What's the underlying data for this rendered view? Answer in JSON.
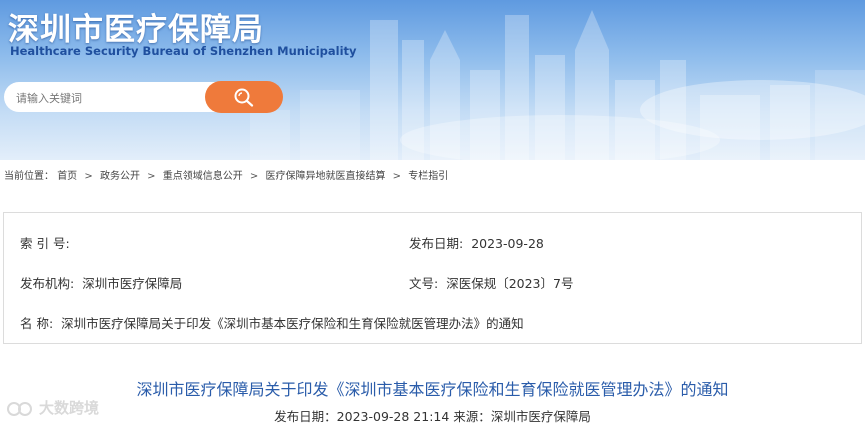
{
  "header": {
    "title": "深圳市医疗保障局",
    "subtitle": "Healthcare Security Bureau of Shenzhen Municipality"
  },
  "search": {
    "placeholder": "请输入关键词",
    "button_icon": "search-icon"
  },
  "breadcrumb": {
    "prefix": "当前位置：",
    "items": [
      "首页",
      "政务公开",
      "重点领域信息公开",
      "医疗保障异地就医直接结算",
      "专栏指引"
    ],
    "separator": ">"
  },
  "info": {
    "index_label": "索 引 号:",
    "index_value": "",
    "date_label": "发布日期:",
    "date_value": "2023-09-28",
    "org_label": "发布机构:",
    "org_value": "深圳市医疗保障局",
    "doc_no_label": "文号:",
    "doc_no_value": "深医保规〔2023〕7号",
    "name_label": "名 称:",
    "name_value": "深圳市医疗保障局关于印发《深圳市基本医疗保险和生育保险就医管理办法》的通知"
  },
  "article": {
    "title": "深圳市医疗保障局关于印发《深圳市基本医疗保险和生育保险就医管理办法》的通知",
    "date_label": "发布日期：",
    "date_value": "2023-09-28 21:14",
    "source_label": "来源：",
    "source_value": "深圳市医疗保障局"
  },
  "watermark": {
    "text": "大数跨境"
  },
  "colors": {
    "search_button": "#ef7a3b",
    "title_blue": "#2a5caa",
    "banner_sky": "#8ebcec"
  }
}
